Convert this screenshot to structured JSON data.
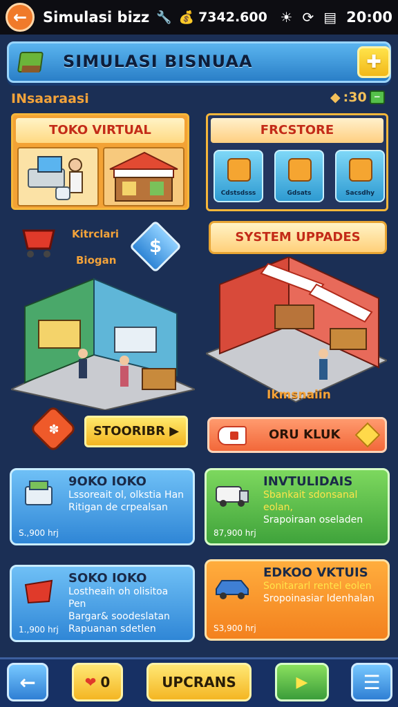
{
  "status_bar": {
    "title": "Simulasi bizz",
    "money": "7342.600",
    "time": "20:00"
  },
  "header": {
    "title": "SIMULASI BISNUAA",
    "action_icon": "plus-icon"
  },
  "section": {
    "label": "INsaaraasi",
    "counter": ":30"
  },
  "toko_panel": {
    "title": "TOKO VIRTUAL"
  },
  "front_panel": {
    "title": "FRCSTORE",
    "buttons": [
      {
        "label": "Cdstsdsss"
      },
      {
        "label": "Gdsats"
      },
      {
        "label": "Sacsdhy"
      }
    ]
  },
  "promo": {
    "cart_text1": "Kitrclari",
    "cart_text2": "Biogan",
    "system_upgrades": "SYSTEM UPPADES"
  },
  "scene": {
    "right_label": "Ikmsnaiin"
  },
  "actions": {
    "store_button": "STOORIBR",
    "club_button": "ORU KLUK"
  },
  "cards": [
    {
      "title": "9OKO IOKO",
      "line1": "Lssoreait ol, olkstia Han",
      "line2": "Ritigan de crpealsan",
      "price": "S.,900 hrj"
    },
    {
      "title": "INVTULIDAIS",
      "line1": "Sbankait sdonsanal eolan,",
      "line2": "Srapoiraan oseladen",
      "price": "87,900 hrj"
    },
    {
      "title": "SOKO IOKO",
      "line1": "Lostheaih oh olisitoa Pen",
      "line2": "Bargar& soodeslatan",
      "line3": "Rapuanan sdetlen",
      "price": "1.,900 hrj"
    },
    {
      "title": "EDKOO VKTUIS",
      "line1": "Sonitararl rentel eolen",
      "line2": "Sropoinasiar Idenhalan",
      "price": "S3,900 hrj"
    }
  ],
  "bottom": {
    "gift_count": "0",
    "upgrade_label": "UPCRANS"
  },
  "colors": {
    "background": "#1b2f55",
    "accent_orange": "#f3a33a",
    "label_red": "#c32b18"
  }
}
